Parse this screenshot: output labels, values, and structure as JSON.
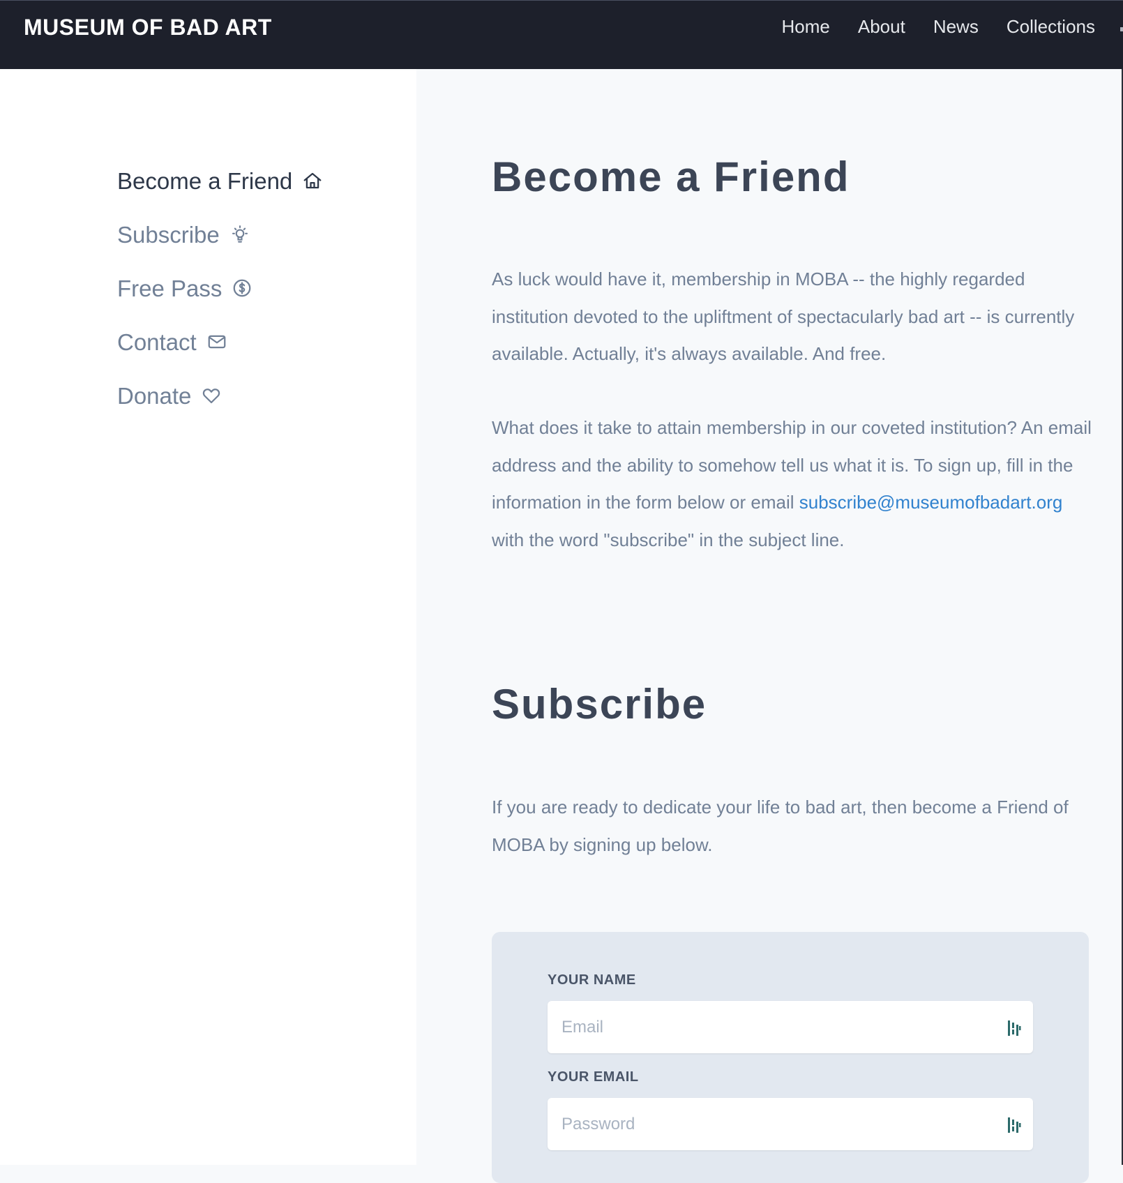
{
  "header": {
    "brand": "MUSEUM OF BAD ART",
    "nav": [
      "Home",
      "About",
      "News",
      "Collections"
    ]
  },
  "sidebar": {
    "items": [
      {
        "label": "Become a Friend",
        "icon": "home-icon",
        "active": true
      },
      {
        "label": "Subscribe",
        "icon": "lightbulb-icon",
        "active": false
      },
      {
        "label": "Free Pass",
        "icon": "dollar-circle-icon",
        "active": false
      },
      {
        "label": "Contact",
        "icon": "mail-icon",
        "active": false
      },
      {
        "label": "Donate",
        "icon": "heart-icon",
        "active": false
      }
    ]
  },
  "main": {
    "title": "Become a Friend",
    "intro": "As luck would have it, membership in MOBA -- the highly regarded institution devoted to the upliftment of spectacularly bad art -- is currently available. Actually, it's always available. And free.",
    "how_prefix": "What does it take to attain membership in our coveted institution? An email address and the ability to somehow tell us what it is. To sign up, fill in the information in the form below or email",
    "email_link": "subscribe@museumofbadart.org",
    "how_suffix": "with the word \"subscribe\" in the subject line.",
    "subscribe_title": "Subscribe",
    "subscribe_text": "If you are ready to dedicate your life to bad art, then become a Friend of MOBA by signing up below."
  },
  "form": {
    "name_label": "YOUR NAME",
    "name_placeholder": "Email",
    "email_label": "YOUR EMAIL",
    "email_placeholder": "Password"
  },
  "colors": {
    "header_bg": "#1d202b",
    "link": "#3182ce",
    "text": "#718096",
    "heading": "#3c4556",
    "card_bg": "#e2e8f0",
    "password_icon": "#2c6a6a"
  }
}
